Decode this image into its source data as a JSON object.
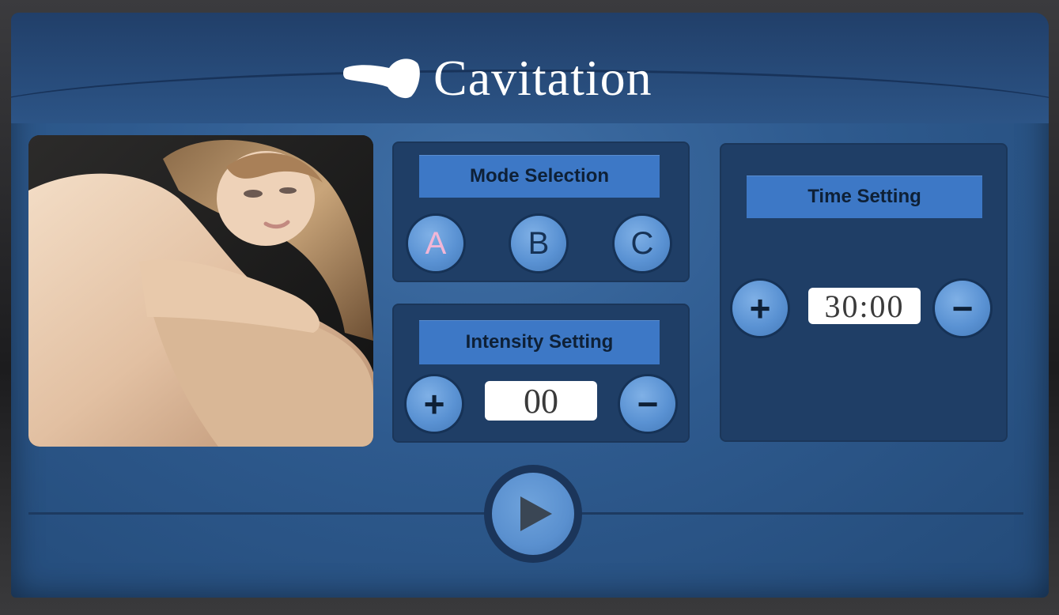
{
  "header": {
    "title": "Cavitation",
    "logo_icon": "cavitation-probe-icon"
  },
  "mode": {
    "label": "Mode Selection",
    "options": [
      "A",
      "B",
      "C"
    ],
    "selected": "A",
    "selected_text_color": "#f2b6d6"
  },
  "intensity": {
    "label": "Intensity Setting",
    "value": "00",
    "plus": "+",
    "minus": "−"
  },
  "time": {
    "label": "Time Setting",
    "value": "30:00",
    "plus": "+",
    "minus": "−"
  },
  "controls": {
    "play_icon": "play-icon"
  },
  "colors": {
    "screen": "#2e5a8e",
    "panel": "#1f3e66",
    "label_bg": "#3d78c6",
    "button": "#5a92d3"
  }
}
